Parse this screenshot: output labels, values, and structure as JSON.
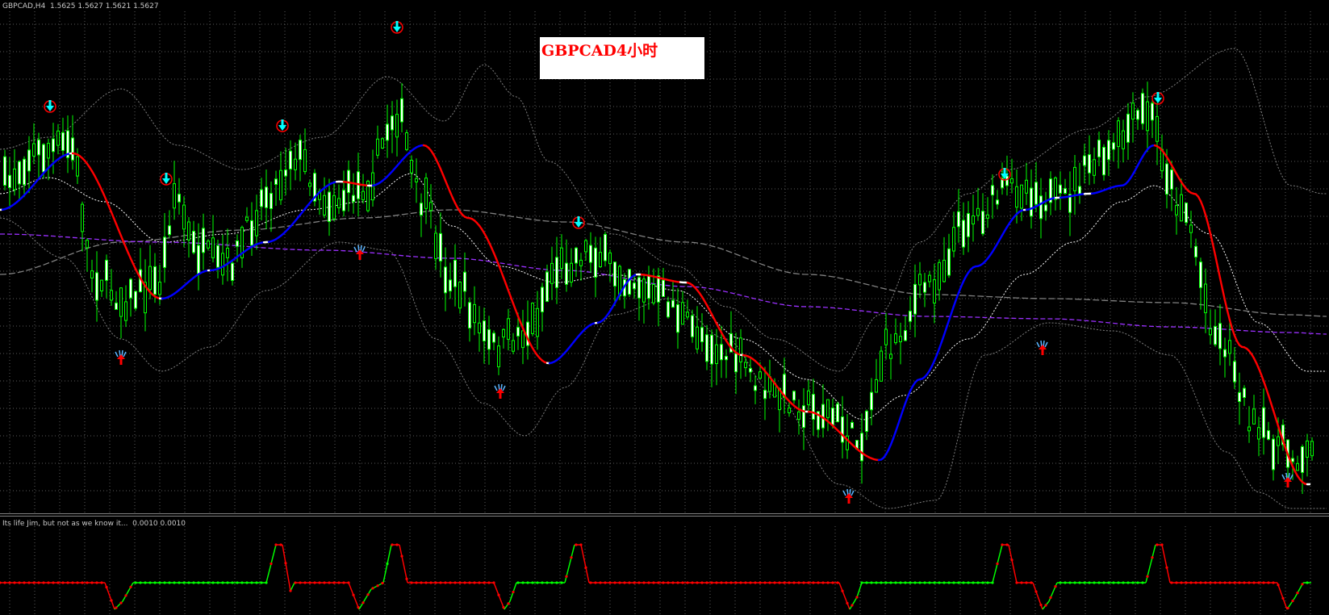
{
  "window": {
    "symbol_header": "GBPCAD,H4  1.5625 1.5627 1.5621 1.5627",
    "indicator_header": "Its life Jim, but not as we know it...  0.0010 0.0010"
  },
  "annotation": {
    "title": "GBPCAD4小时"
  },
  "colors": {
    "background": "#000000",
    "grid": "#5a5a5a",
    "candle": "#00ff00",
    "candle_body": "#ffffff",
    "ma_up": "#0000ff",
    "ma_down": "#ff0000",
    "ma_flat": "#ffffff",
    "band": "#808080",
    "mid_band": "#ffffff",
    "slow_ma": "#9b30ff",
    "long_ma": "#808080",
    "sell_signal": "#00ffff",
    "buy_signal": "#ff0000",
    "oscillator_up": "#00ff00",
    "oscillator_down": "#ff0000"
  },
  "icons": {
    "sell_signal": "down-arrow-hand-icon",
    "buy_signal": "up-arrow-hand-icon"
  }
}
